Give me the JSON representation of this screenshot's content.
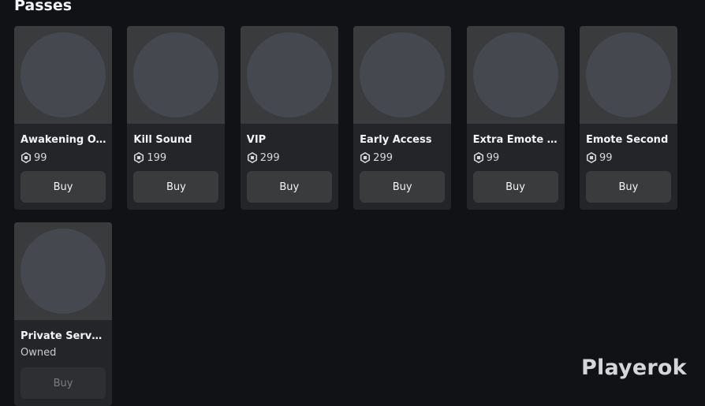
{
  "section": {
    "title": "Passes"
  },
  "passes": [
    {
      "name": "Awakening O...",
      "price": "99",
      "button": "Buy",
      "owned": false
    },
    {
      "name": "Kill Sound",
      "price": "199",
      "button": "Buy",
      "owned": false
    },
    {
      "name": "VIP",
      "price": "299",
      "button": "Buy",
      "owned": false
    },
    {
      "name": "Early Access",
      "price": "299",
      "button": "Buy",
      "owned": false
    },
    {
      "name": "Extra Emote S...",
      "price": "99",
      "button": "Buy",
      "owned": false
    },
    {
      "name": "Emote Second",
      "price": "99",
      "button": "Buy",
      "owned": false
    },
    {
      "name": "Private Server...",
      "status": "Owned",
      "button": "Buy",
      "owned": true
    }
  ],
  "watermark": {
    "text": "Playerok"
  },
  "icons": {
    "price_icon": "robux-icon",
    "thumbnail": "placeholder-thumbnail"
  }
}
